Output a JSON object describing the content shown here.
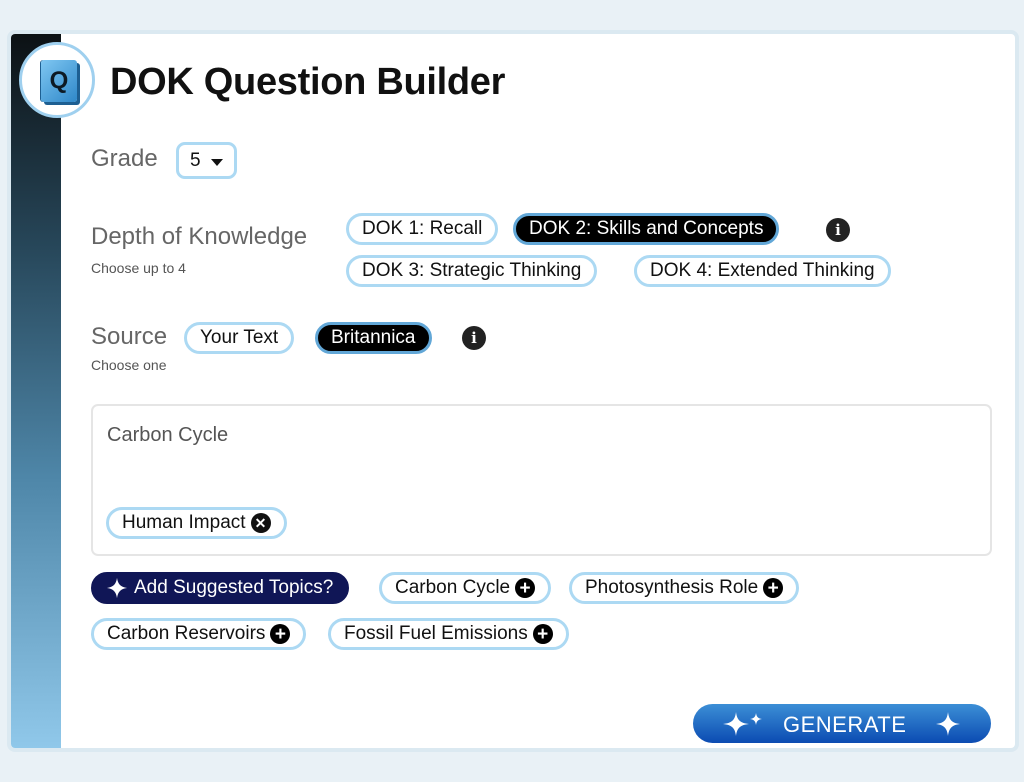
{
  "header": {
    "title": "DOK Question Builder",
    "logo_letter": "Q"
  },
  "grade": {
    "label": "Grade",
    "selected": "5"
  },
  "dok": {
    "label": "Depth of Knowledge",
    "hint": "Choose up to 4",
    "options": [
      {
        "label": "DOK 1: Recall",
        "selected": false
      },
      {
        "label": "DOK 2: Skills and Concepts",
        "selected": true
      },
      {
        "label": "DOK 3: Strategic Thinking",
        "selected": false
      },
      {
        "label": "DOK 4: Extended Thinking",
        "selected": false
      }
    ],
    "info_glyph": "i"
  },
  "source": {
    "label": "Source",
    "hint": "Choose one",
    "options": [
      {
        "label": "Your Text",
        "selected": false
      },
      {
        "label": "Britannica",
        "selected": true
      }
    ],
    "info_glyph": "i"
  },
  "topic_box": {
    "text": "Carbon Cycle",
    "tags": [
      {
        "label": "Human Impact"
      }
    ]
  },
  "suggestions": {
    "button_label": "Add Suggested Topics?",
    "topics": [
      "Carbon Cycle",
      "Photosynthesis Role",
      "Carbon Reservoirs",
      "Fossil Fuel Emissions"
    ]
  },
  "generate_label": "GENERATE",
  "colors": {
    "accent": "#101656",
    "chip_border": "#acd9f3",
    "generate": "#0b4bb2",
    "selected_chip": "#000000"
  }
}
